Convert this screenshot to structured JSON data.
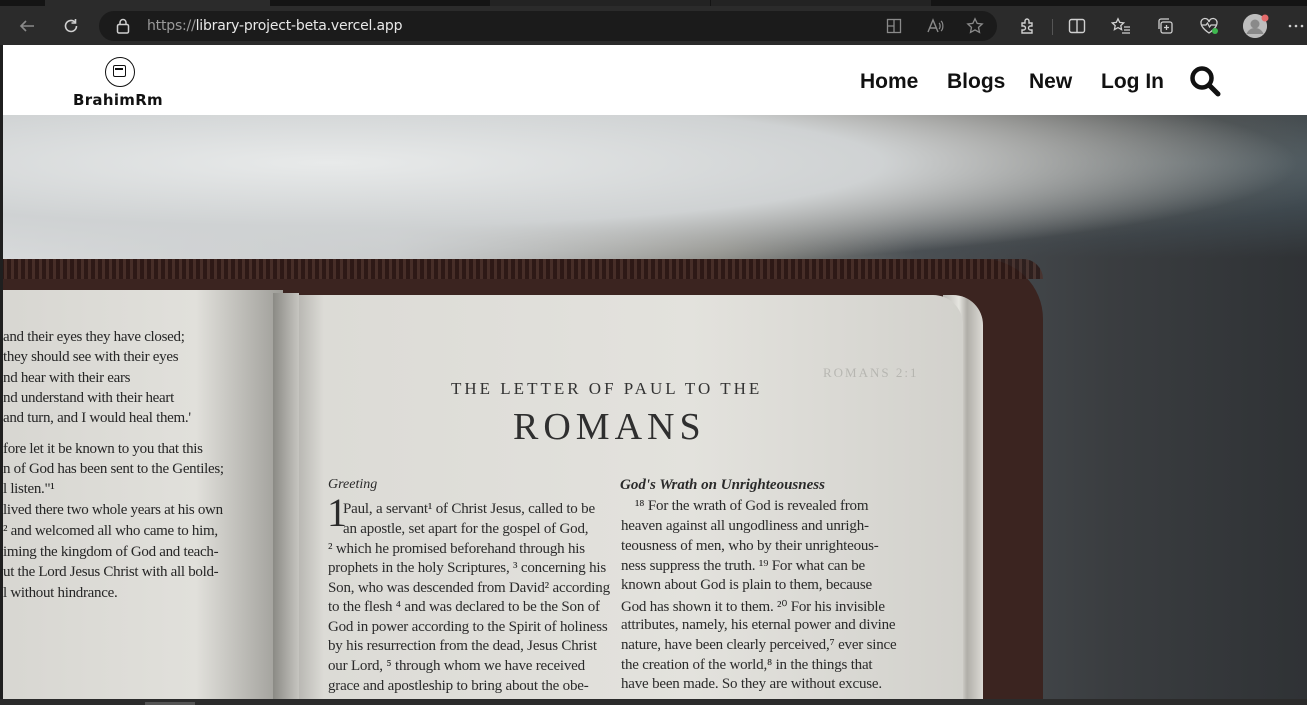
{
  "browser": {
    "url_protocol": "https://",
    "url_host": "library-project-beta.vercel.app"
  },
  "site": {
    "logo_text": "BrahimRm",
    "nav": [
      {
        "label": "Home"
      },
      {
        "label": "Blogs"
      },
      {
        "label": "New"
      },
      {
        "label": "Log In"
      }
    ]
  },
  "hero": {
    "left_page_lines": [
      "and their eyes they have closed;",
      "they should see with their eyes",
      "nd hear with their ears",
      "nd understand with their heart",
      "and turn, and I would heal them.'",
      "fore let it be known to you that this",
      "n of God has been sent to the Gentiles;",
      "l listen.\"¹",
      "lived there two whole years at his own",
      "² and welcomed all who came to him,",
      "iming the kingdom of God and teach-",
      "ut the Lord Jesus Christ with all bold-",
      "l without hindrance."
    ],
    "book_header": "THE LETTER OF PAUL TO THE",
    "book_title": "ROMANS",
    "left_section_heading": "Greeting",
    "right_section_heading": "God's Wrath on Unrighteousness",
    "left_column": [
      "Paul, a servant¹ of Christ Jesus, called to be",
      "an apostle, set apart for the gospel of God,",
      "² which he promised beforehand through his",
      "prophets in the holy Scriptures, ³ concerning his",
      "Son, who was descended from David² according",
      "to the flesh ⁴ and was declared to be the Son of",
      "God in power according to the Spirit of holiness",
      "by his resurrection from the dead, Jesus Christ",
      "our Lord, ⁵ through whom we have received",
      "grace and apostleship to bring about the obe-"
    ],
    "right_column": [
      "¹⁸ For the wrath of God is revealed from",
      "heaven against all ungodliness and unrigh-",
      "teousness of men, who by their unrighteous-",
      "ness suppress the truth. ¹⁹ For what can be",
      "known about God is plain to them, because",
      "God has shown it to them. ²⁰ For his invisible",
      "attributes, namely, his eternal power and divine",
      "nature, have been clearly perceived,⁷ ever since",
      "the creation of the world,⁸ in the things that",
      "have been made. So they are without excuse."
    ],
    "faint_header": "ROMANS 2:1"
  }
}
